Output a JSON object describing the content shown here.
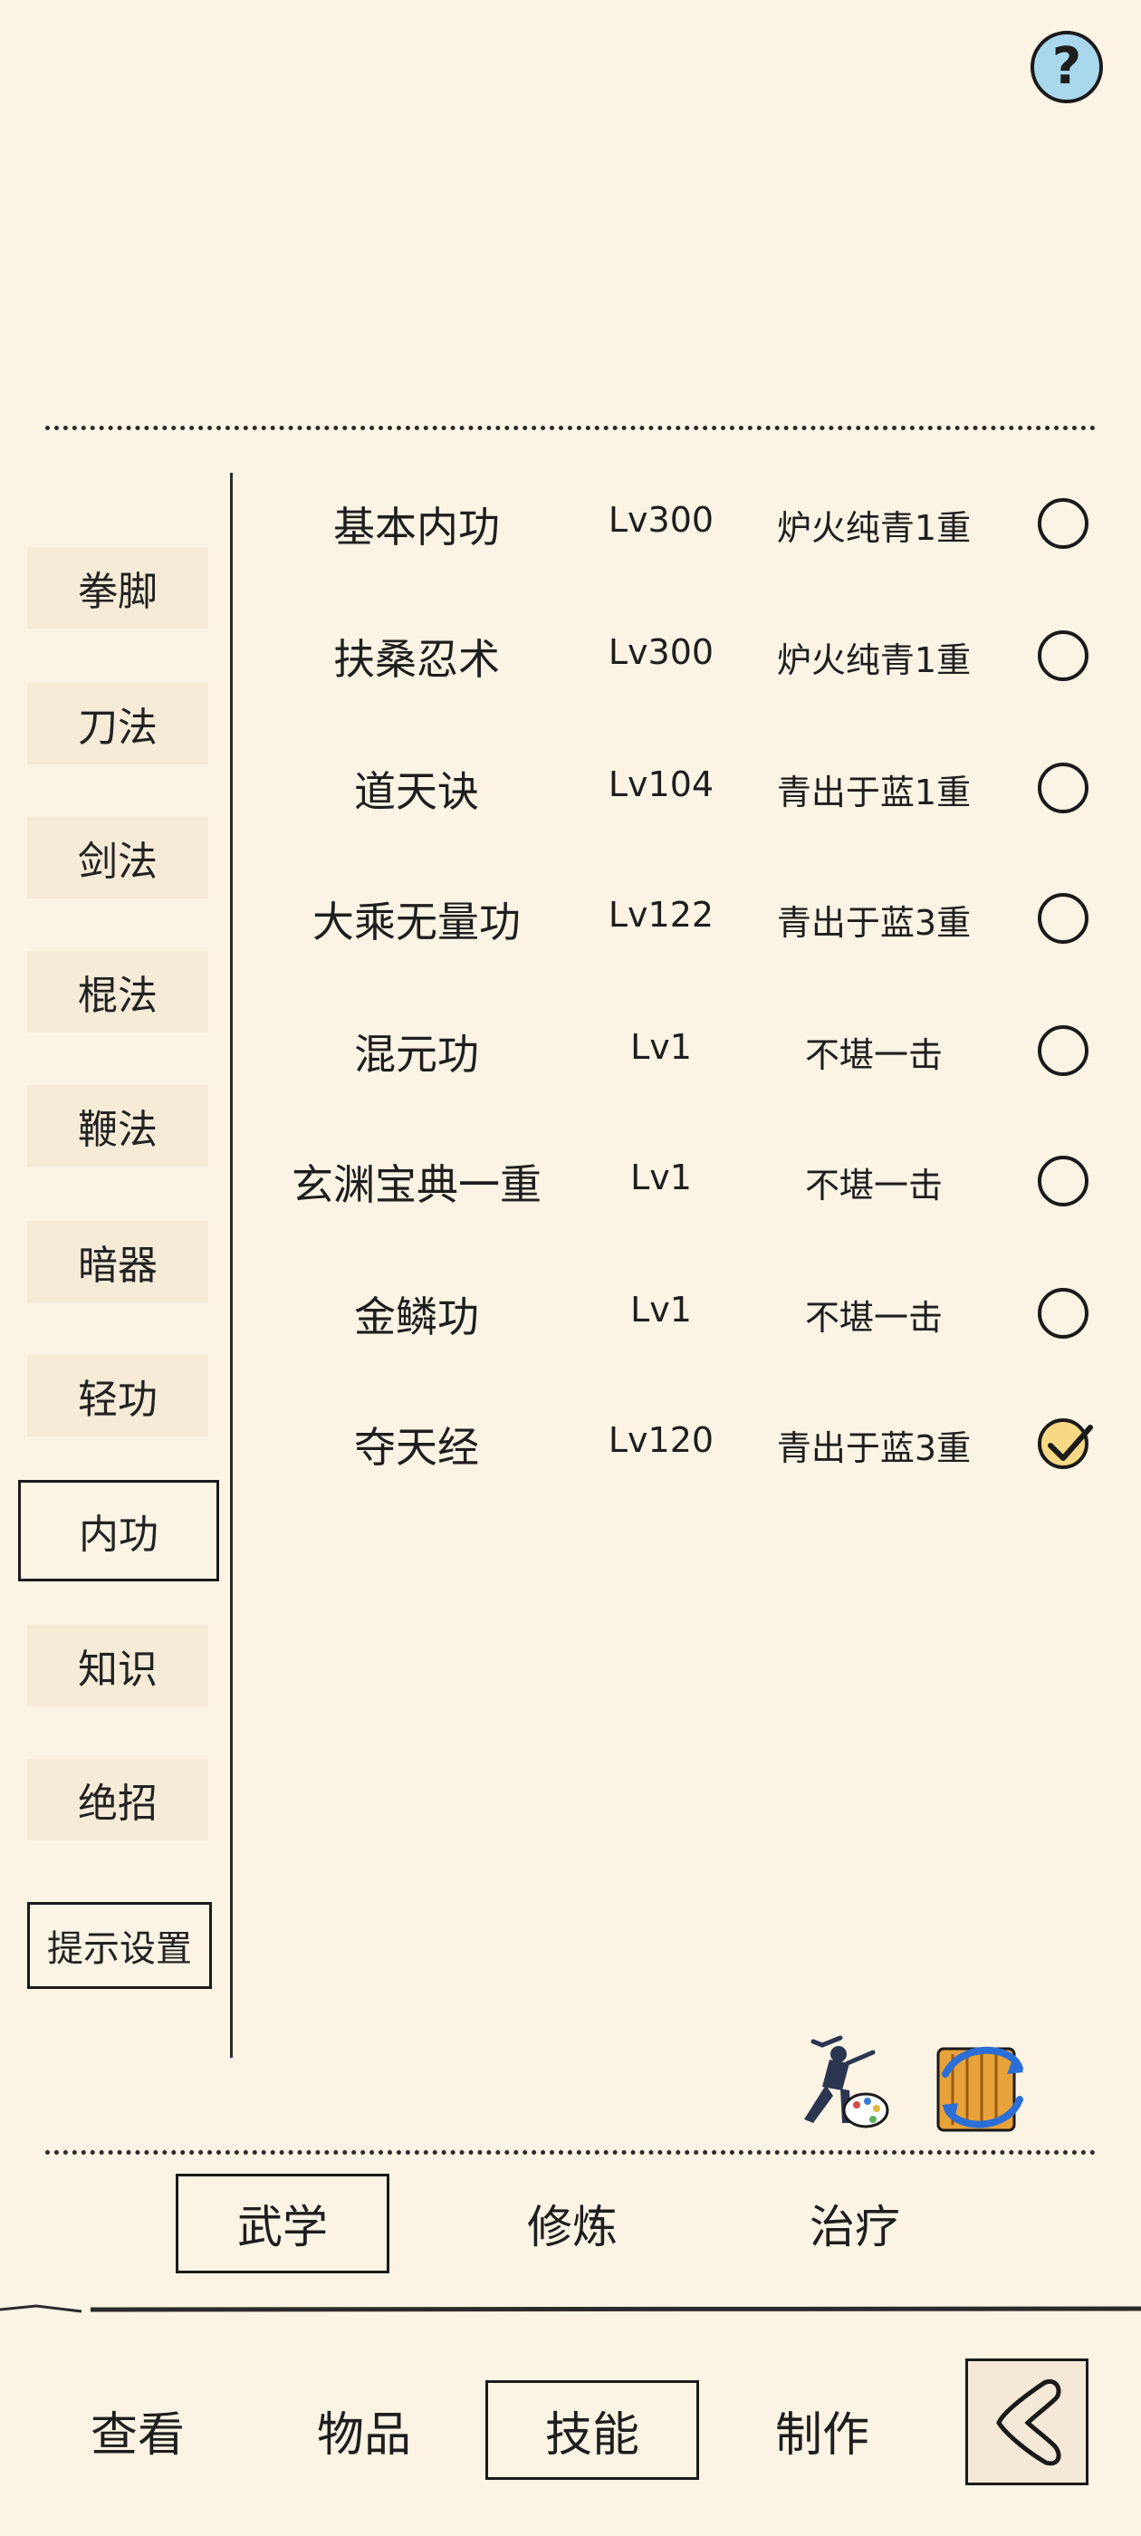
{
  "help": {
    "icon": "question-mark-icon",
    "label": "?"
  },
  "sidebar": {
    "items": [
      {
        "label": "拳脚"
      },
      {
        "label": "刀法"
      },
      {
        "label": "剑法"
      },
      {
        "label": "棍法"
      },
      {
        "label": "鞭法"
      },
      {
        "label": "暗器"
      },
      {
        "label": "轻功"
      },
      {
        "label": "内功",
        "active": true
      },
      {
        "label": "知识"
      },
      {
        "label": "绝招"
      }
    ],
    "hint_settings_label": "提示设置"
  },
  "skills": [
    {
      "name": "基本内功",
      "level": "Lv300",
      "rank": "炉火纯青1重",
      "checked": false
    },
    {
      "name": "扶桑忍术",
      "level": "Lv300",
      "rank": "炉火纯青1重",
      "checked": false
    },
    {
      "name": "道天诀",
      "level": "Lv104",
      "rank": "青出于蓝1重",
      "checked": false
    },
    {
      "name": "大乘无量功",
      "level": "Lv122",
      "rank": "青出于蓝3重",
      "checked": false
    },
    {
      "name": "混元功",
      "level": "Lv1",
      "rank": "不堪一击",
      "checked": false
    },
    {
      "name": "玄渊宝典一重",
      "level": "Lv1",
      "rank": "不堪一击",
      "checked": false
    },
    {
      "name": "金鳞功",
      "level": "Lv1",
      "rank": "不堪一击",
      "checked": false
    },
    {
      "name": "夺天经",
      "level": "Lv120",
      "rank": "青出于蓝3重",
      "checked": true
    }
  ],
  "action_icons": [
    "martial-artist-palette-icon",
    "scroll-refresh-icon"
  ],
  "sub_tabs": [
    {
      "label": "武学",
      "active": true
    },
    {
      "label": "修炼"
    },
    {
      "label": "治疗"
    }
  ],
  "bottom_nav": [
    {
      "label": "查看"
    },
    {
      "label": "物品"
    },
    {
      "label": "技能",
      "active": true
    },
    {
      "label": "制作"
    }
  ],
  "back_button": {
    "icon": "back-arrow-icon"
  },
  "colors": {
    "background": "#fbf3e3",
    "checked_fill": "#f7d884",
    "help_fill": "#a9d8ec",
    "ink": "#1a1a1a"
  }
}
